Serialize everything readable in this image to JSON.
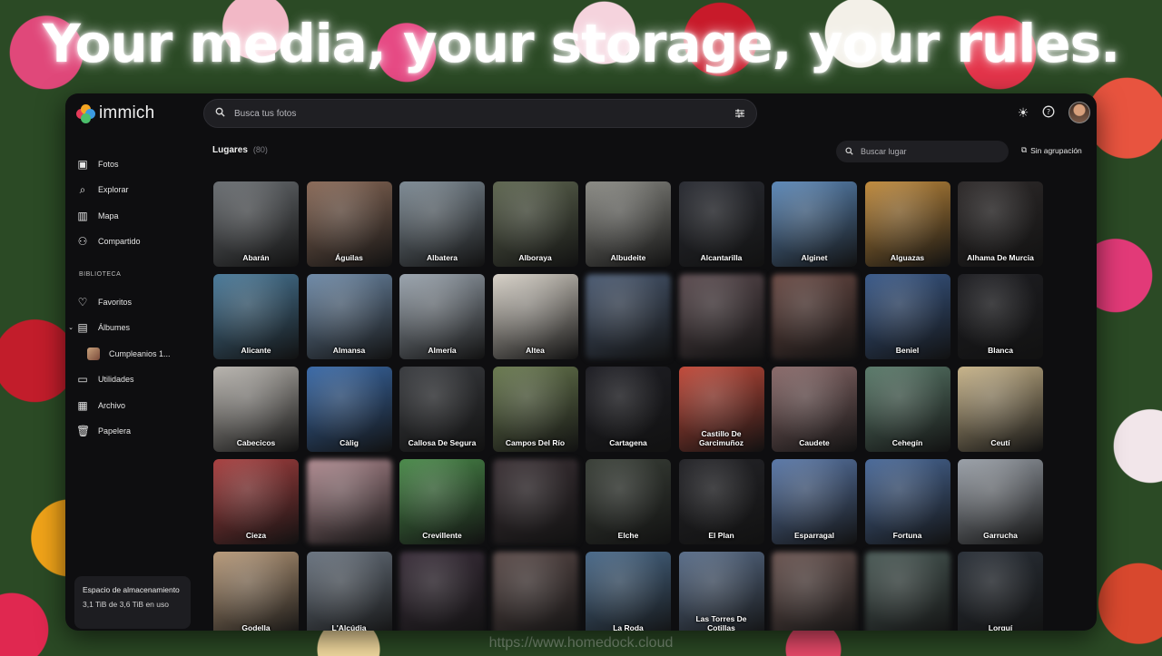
{
  "hero": {
    "title": "Your media, your storage, your rules."
  },
  "watermark": "https://www.homedock.cloud",
  "app": {
    "name": "immich"
  },
  "search": {
    "placeholder": "Busca tus fotos"
  },
  "topbar_icons": [
    "tune-icon",
    "theme-toggle-icon",
    "help-icon",
    "avatar"
  ],
  "sidebar": {
    "items": [
      {
        "label": "Fotos",
        "icon": "photos-icon"
      },
      {
        "label": "Explorar",
        "icon": "search-icon"
      },
      {
        "label": "Mapa",
        "icon": "map-icon"
      },
      {
        "label": "Compartido",
        "icon": "people-icon"
      }
    ],
    "library_label": "BIBLIOTECA",
    "library": [
      {
        "label": "Favoritos",
        "icon": "heart-icon"
      },
      {
        "label": "Álbumes",
        "icon": "album-icon"
      },
      {
        "label": "Cumpleanios 1...",
        "icon": "album-thumb"
      },
      {
        "label": "Utilidades",
        "icon": "toolbox-icon"
      },
      {
        "label": "Archivo",
        "icon": "archive-icon"
      },
      {
        "label": "Papelera",
        "icon": "trash-icon"
      }
    ],
    "storage": {
      "title": "Espacio de almacenamiento",
      "used": "3,1 TiB de 3,6 TiB en uso"
    }
  },
  "places": {
    "title": "Lugares",
    "count": "(80)",
    "search_placeholder": "Buscar lugar",
    "group_label": "Sin agrupación",
    "items": [
      {
        "name": "Abarán",
        "color": "#6a6e72"
      },
      {
        "name": "Águilas",
        "color": "#8a6a58"
      },
      {
        "name": "Albatera",
        "color": "#7d8a94"
      },
      {
        "name": "Alboraya",
        "color": "#5e6650"
      },
      {
        "name": "Albudeite",
        "color": "#8a8a84"
      },
      {
        "name": "Alcantarilla",
        "color": "#2a2c33"
      },
      {
        "name": "Alginet",
        "color": "#5c88b8"
      },
      {
        "name": "Alguazas",
        "color": "#c08a3c"
      },
      {
        "name": "Alhama De Murcia",
        "color": "#2e2a2a"
      },
      {
        "name": "Alicante",
        "color": "#4a7a9a"
      },
      {
        "name": "Almansa",
        "color": "#6e8aa8"
      },
      {
        "name": "Almería",
        "color": "#9aa4ae"
      },
      {
        "name": "Altea",
        "color": "#d8d2c8"
      },
      {
        "name": "",
        "color": "#4a5a72"
      },
      {
        "name": "",
        "color": "#5a4a4e"
      },
      {
        "name": "",
        "color": "#6a4a44"
      },
      {
        "name": "Beniel",
        "color": "#3a5a8a"
      },
      {
        "name": "Blanca",
        "color": "#1e1e22"
      },
      {
        "name": "Cabecicos",
        "color": "#b8b4ae"
      },
      {
        "name": "Càlig",
        "color": "#3a6aa8"
      },
      {
        "name": "Callosa De Segura",
        "color": "#3a3c40"
      },
      {
        "name": "Campos Del Río",
        "color": "#6a7a50"
      },
      {
        "name": "Cartagena",
        "color": "#1e1e24"
      },
      {
        "name": "Castillo De Garcimuñoz",
        "color": "#c24a3a"
      },
      {
        "name": "Caudete",
        "color": "#8a6a6a"
      },
      {
        "name": "Cehegín",
        "color": "#5a7a6a"
      },
      {
        "name": "Ceutí",
        "color": "#c8b48a"
      },
      {
        "name": "Cieza",
        "color": "#a84040"
      },
      {
        "name": "",
        "color": "#b08a90"
      },
      {
        "name": "Crevillente",
        "color": "#4a8a4a"
      },
      {
        "name": "",
        "color": "#3a3034"
      },
      {
        "name": "Elche",
        "color": "#3a4038"
      },
      {
        "name": "El Plan",
        "color": "#242428"
      },
      {
        "name": "Esparragal",
        "color": "#5a78a8"
      },
      {
        "name": "Fortuna",
        "color": "#4a6a9a"
      },
      {
        "name": "Garrucha",
        "color": "#9aa0a8"
      },
      {
        "name": "Godella",
        "color": "#b89a7a"
      },
      {
        "name": "L'Alcúdia",
        "color": "#6a7480"
      },
      {
        "name": "",
        "color": "#3a2e3a"
      },
      {
        "name": "",
        "color": "#5a4a48"
      },
      {
        "name": "La Roda",
        "color": "#4a6a8a"
      },
      {
        "name": "Las Torres De Cotillas",
        "color": "#5a6e8a"
      },
      {
        "name": "",
        "color": "#6a5450"
      },
      {
        "name": "",
        "color": "#4a5a56"
      },
      {
        "name": "Lorquí",
        "color": "#2a3038"
      }
    ]
  }
}
